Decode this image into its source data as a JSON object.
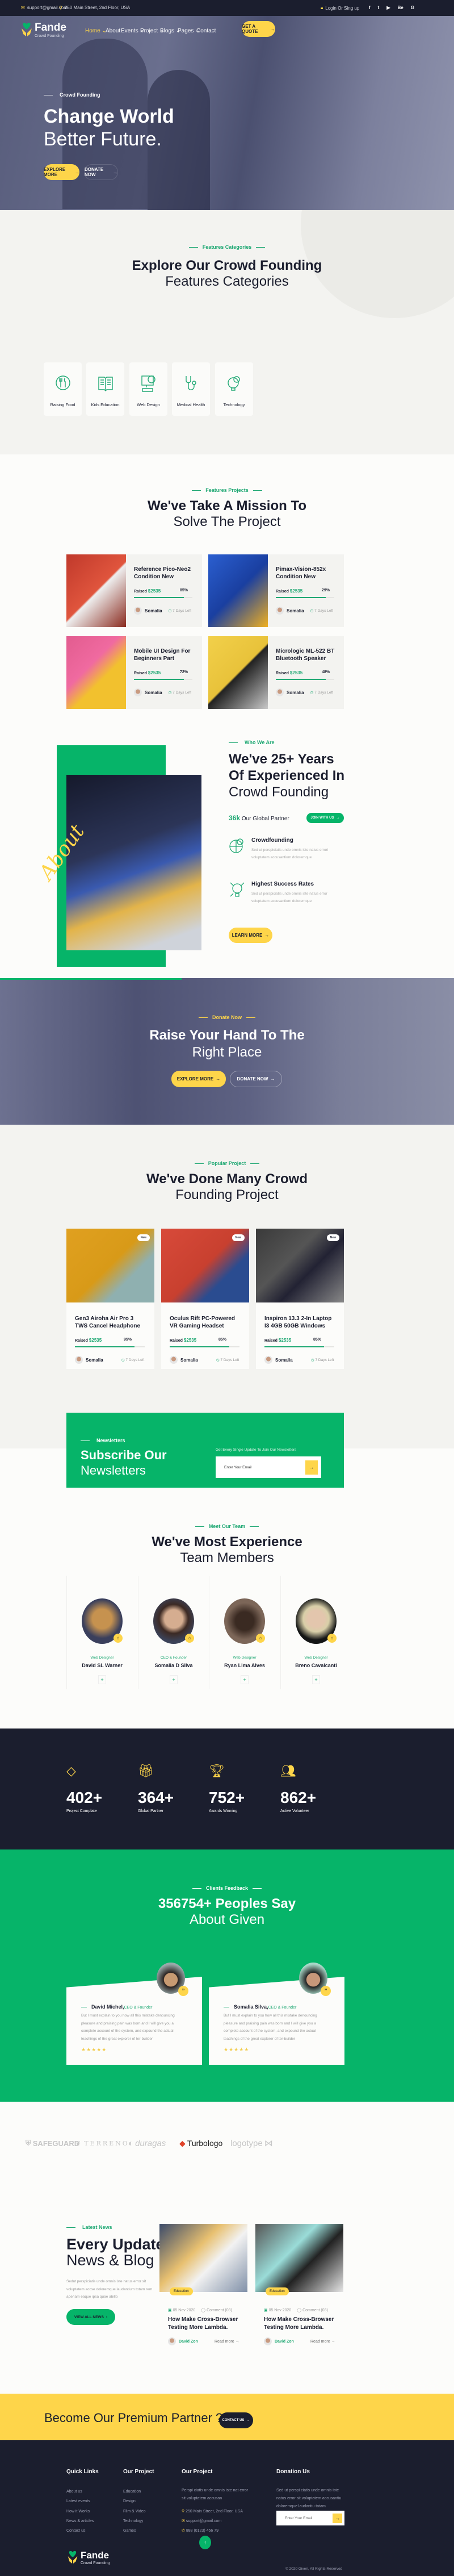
{
  "colors": {
    "primary_green": "#06b469",
    "dark": "#1b1e2e",
    "accent_yellow": "#fed54a",
    "tag_green": "#1fa873"
  },
  "topbar": {
    "email": "support@gmail.com",
    "address": "250 Main Street, 2nd Floor, USA",
    "login": "Login Or Sing up",
    "social": [
      {
        "icon": "facebook-icon",
        "glyph": "f"
      },
      {
        "icon": "twitter-icon",
        "glyph": "t"
      },
      {
        "icon": "youtube-icon",
        "glyph": "▶"
      },
      {
        "icon": "behance-icon",
        "glyph": "Be"
      },
      {
        "icon": "google-icon",
        "glyph": "G"
      }
    ]
  },
  "brand": {
    "name": "Fande",
    "tagline": "Crowd Founding"
  },
  "nav": {
    "items": [
      {
        "label": "Home",
        "active": true,
        "dropdown": true
      },
      {
        "label": "About"
      },
      {
        "label": "Events",
        "dropdown": true
      },
      {
        "label": "Project",
        "dropdown": true
      },
      {
        "label": "Blogs",
        "dropdown": true
      },
      {
        "label": "Pages",
        "dropdown": true
      },
      {
        "label": "Contact"
      }
    ],
    "cta": "Get A Quote"
  },
  "hero": {
    "tag": "Crowd Founding",
    "title_bold": "Change World",
    "title_light": "Better Future.",
    "explore": "Explore More",
    "donate": "Donate Now"
  },
  "features": {
    "tag": "Features Categories",
    "title_bold": "Explore Our Crowd Founding",
    "title_light": "Features Categories",
    "items": [
      {
        "label": "Raising Food",
        "icon": "food-plate-icon"
      },
      {
        "label": "Kids Education",
        "icon": "book-icon"
      },
      {
        "label": "Web Design",
        "icon": "computer-code-icon"
      },
      {
        "label": "Medical Health",
        "icon": "stethoscope-icon"
      },
      {
        "label": "Technology",
        "icon": "lightbulb-gear-icon"
      }
    ]
  },
  "projects": {
    "tag": "Features Projects",
    "title_bold": "We've Take A Mission To",
    "title_light": "Solve The Project",
    "raised_label": "Raised",
    "items": [
      {
        "title": "Reference Pico-Neo2 Condition New",
        "raised": "$2535",
        "percent": "85%",
        "progress": 85,
        "author": "Somalia",
        "days": "7 Days Left"
      },
      {
        "title": "Pimax-Vision-852x Condition New",
        "raised": "$2535",
        "percent": "29%",
        "progress": 85,
        "author": "Somalia",
        "days": "7 Days Left"
      },
      {
        "title": "Mobile UI Design For Beginners Part",
        "raised": "$2535",
        "percent": "72%",
        "progress": 85,
        "author": "Somalia",
        "days": "7 Days Left"
      },
      {
        "title": "Micrologic ML-522 BT Bluetooth Speaker",
        "raised": "$2535",
        "percent": "48%",
        "progress": 85,
        "author": "Somalia",
        "days": "7 Days Left"
      }
    ]
  },
  "about": {
    "script_word": "About",
    "tag": "Who We Are",
    "title_bold": "We've 25+ Years Of Experienced In",
    "title_light": "Crowd Founding",
    "partner_count": "36k",
    "partner_label": "Our Global Partner",
    "join": "Join With Us",
    "items": [
      {
        "title": "Crowdfounding",
        "text": "Sed ut perspiciatis unde omnis iste natus errori voluptatem accusantium doloremque",
        "icon": "globe-money-icon"
      },
      {
        "title": "Highest Success Rates",
        "text": "Sed ut perspiciatis unde omnis iste natus error voluptatem accusantium doloremque",
        "icon": "lightbulb-dollar-icon"
      }
    ],
    "learn": "Learn More"
  },
  "cta": {
    "tag": "Donate Now",
    "title_bold": "Raise Your Hand To The",
    "title_light": "Right Place",
    "explore": "Explore More",
    "donate": "Donate Now"
  },
  "popular": {
    "tag": "Popular Project",
    "title_bold": "We've Done Many Crowd",
    "title_light": "Founding Project",
    "badge": "New",
    "raised_label": "Raised",
    "items": [
      {
        "title": "Gen3 Airoha Air Pro 3 TWS Cancel Headphone",
        "raised": "$2535",
        "percent": "95%",
        "progress": 85,
        "author": "Somalia",
        "days": "7 Days Left"
      },
      {
        "title": "Oculus Rift PC-Powered VR Gaming Headset",
        "raised": "$2535",
        "percent": "85%",
        "progress": 85,
        "author": "Somalia",
        "days": "7 Days Left"
      },
      {
        "title": "Inspiron 13.3 2-In Laptop I3 4GB 50GB Windows",
        "raised": "$2535",
        "percent": "85%",
        "progress": 85,
        "author": "Somalia",
        "days": "7 Days Left"
      }
    ]
  },
  "newsletter": {
    "tag": "Newsletters",
    "title_bold": "Subscribe Our",
    "title_light": "Newsletters",
    "subtitle": "Get Every Single Update To Join Our Newsletters",
    "placeholder": "Enter Your Email"
  },
  "team": {
    "tag": "Meet Our Team",
    "title_bold": "We've Most Experience",
    "title_light": "Team Members",
    "members": [
      {
        "role": "Web Designer",
        "name": "David SL Warner"
      },
      {
        "role": "CEO & Founder",
        "name": "Somalia D Silva"
      },
      {
        "role": "Web Designer",
        "name": "Ryan Lima Alves"
      },
      {
        "role": "Web Designer",
        "name": "Breno Cavalcanti"
      }
    ]
  },
  "counters": [
    {
      "value": "402+",
      "label": "Project Complate",
      "icon": "diamond-icon"
    },
    {
      "value": "364+",
      "label": "Global Partner",
      "icon": "gift-icon"
    },
    {
      "value": "752+",
      "label": "Awards Winning",
      "icon": "trophy-icon"
    },
    {
      "value": "862+",
      "label": "Active Volunteer",
      "icon": "team-icon"
    }
  ],
  "testimonials": {
    "tag": "Clients Feedback",
    "title_bold": "356754+ Peoples Say",
    "title_light": "About Given",
    "items": [
      {
        "name": "David Michel,",
        "role": "CEO & Founder",
        "text": "But I must explain to you how all this mistake denouncing pleasure and praising pain was born and I will give you a complete account of the system, and expound the actual teachings of the great explorer of ter-builder",
        "rating": 5
      },
      {
        "name": "Somalia Silva,",
        "role": "CEO & Founder",
        "text": "But I must explain to you how all this mistake denouncing pleasure and praising pain was born and I will give you a complete account of the system, and expound the actual teachings of the great explorer of ter-builder",
        "rating": 5
      }
    ]
  },
  "logos": [
    "SAFEGUARD",
    "TERRENO",
    "duragas",
    "Turbologo",
    "logotype"
  ],
  "blog": {
    "tag": "Latest News",
    "title_bold": "Every Update",
    "title_light": "News & Blog",
    "text": "Sedut perspiciatis unde omnis iste natus error sit voluptatem accse doloremque laudantium totam rem aperiam eaque ipsa quae abillo",
    "button": "View All News",
    "posts": [
      {
        "category": "Education",
        "date": "05 Nov 2020",
        "comments": "Comment (03)",
        "title": "How Make Cross-Browser Testing More Lambda.",
        "author": "David Zon",
        "read": "Read more"
      },
      {
        "category": "Education",
        "date": "05 Nov 2020",
        "comments": "Comment (03)",
        "title": "How Make Cross-Browser Testing More Lambda.",
        "author": "David Zon",
        "read": "Read more"
      }
    ]
  },
  "partner": {
    "pre": "Become Our",
    "bold": "Premium",
    "post": "Partner ?",
    "button": "Contact Us"
  },
  "footer": {
    "quick": {
      "title": "Quick Links",
      "links": [
        "About us",
        "Latest events",
        "How it Works",
        "News & articles",
        "Contact us"
      ]
    },
    "project": {
      "title": "Our Project",
      "links": [
        "Education",
        "Design",
        "Film & Video",
        "Technology",
        "Games"
      ]
    },
    "contact": {
      "title": "Our Project",
      "text": "Perspi ciatis unde omnis iste nat error sit voluptatem accusan",
      "address": "250 Main Street, 2nd Floor, USA",
      "email": "support@gmail.com",
      "phone": "888 (0123) 456 79"
    },
    "donation": {
      "title": "Donation Us",
      "text": "Sed ut perspi ciatis unde omnis iste natus error sit voluptatem accusantiu doloremque laudantiu totam",
      "placeholder": "Enter Your Email"
    },
    "copyright": "© 2020 Given, All Rights Reserved"
  }
}
